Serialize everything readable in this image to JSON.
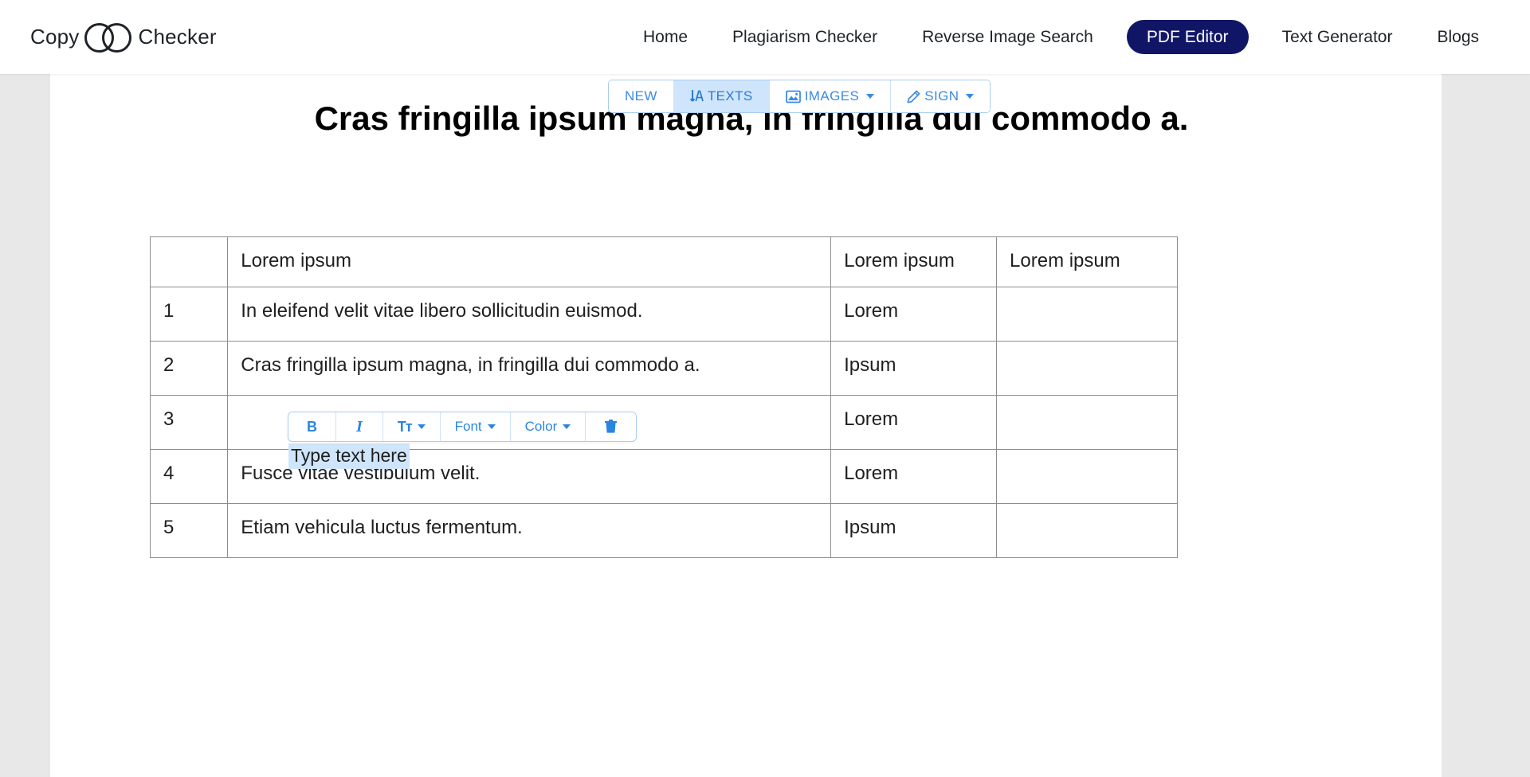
{
  "brand": {
    "word_left": "Copy",
    "word_right": "Checker",
    "logo_green": "#2bb673",
    "logo_blue": "#1a73d4"
  },
  "nav": {
    "items": [
      {
        "label": "Home",
        "active": false
      },
      {
        "label": "Plagiarism Checker",
        "active": false
      },
      {
        "label": "Reverse Image Search",
        "active": false
      },
      {
        "label": "PDF Editor",
        "active": true
      },
      {
        "label": "Text Generator",
        "active": false
      },
      {
        "label": "Blogs",
        "active": false
      }
    ],
    "active_pill_color": "#101566"
  },
  "editor_toolbar": {
    "buttons": [
      {
        "label": "NEW",
        "icon": "",
        "caret": false,
        "active": false
      },
      {
        "label": "TEXTS",
        "icon": "text-insert-icon",
        "caret": false,
        "active": true
      },
      {
        "label": "IMAGES",
        "icon": "image-icon",
        "caret": true,
        "active": false
      },
      {
        "label": "SIGN",
        "icon": "pen-icon",
        "caret": true,
        "active": false
      }
    ],
    "accent_color": "#3b8ae5",
    "active_bg": "#cfe5fb"
  },
  "document": {
    "title": "Cras fringilla ipsum magna, in fringilla dui commodo a.",
    "table": {
      "header": [
        "",
        "Lorem ipsum",
        "Lorem ipsum",
        "Lorem ipsum"
      ],
      "rows": [
        [
          "1",
          "In eleifend velit vitae libero sollicitudin euismod.",
          "Lorem",
          ""
        ],
        [
          "2",
          "Cras fringilla ipsum magna, in fringilla dui commodo a.",
          "Ipsum",
          ""
        ],
        [
          "3",
          "",
          "Lorem",
          ""
        ],
        [
          "4",
          "Fusce vitae vestibulum velit.",
          "Lorem",
          ""
        ],
        [
          "5",
          "Etiam vehicula luctus fermentum.",
          "Ipsum",
          ""
        ]
      ]
    }
  },
  "format_toolbar": {
    "bold_label": "B",
    "italic_label": "I",
    "size_label": "Tт",
    "font_label": "Font",
    "color_label": "Color",
    "delete_icon": "trash-icon",
    "accent_color": "#2b85e0"
  },
  "text_box": {
    "placeholder_text": "Type text here",
    "selection_color": "#cfe5fb"
  }
}
